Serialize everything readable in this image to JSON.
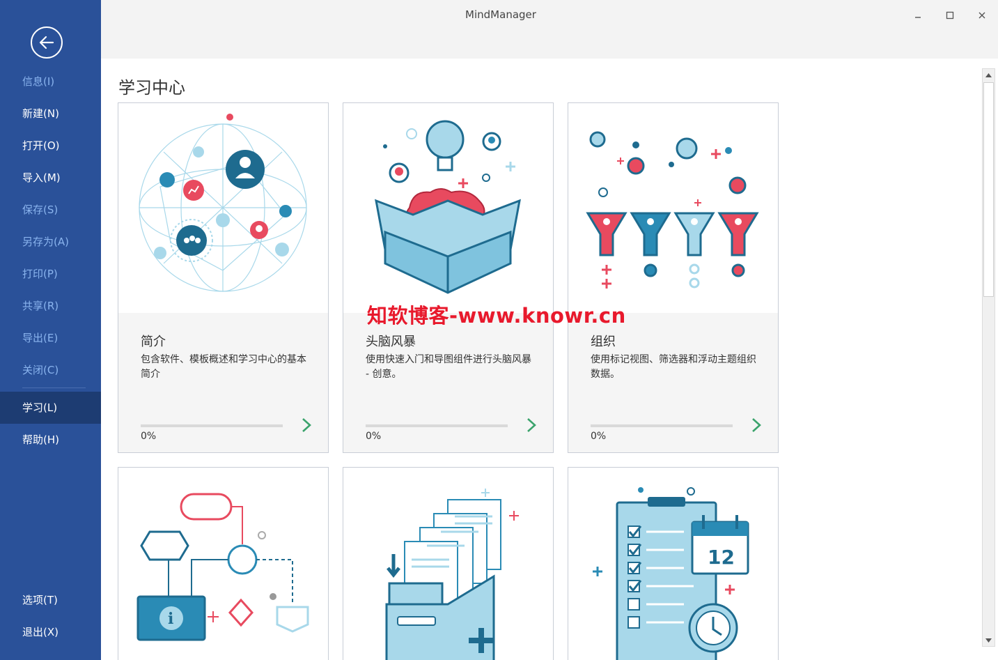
{
  "window": {
    "title": "MindManager"
  },
  "sidebar": {
    "items": [
      {
        "label": "信息(I)",
        "muted": true
      },
      {
        "label": "新建(N)",
        "muted": false
      },
      {
        "label": "打开(O)",
        "muted": false
      },
      {
        "label": "导入(M)",
        "muted": false
      },
      {
        "label": "保存(S)",
        "muted": true
      },
      {
        "label": "另存为(A)",
        "muted": true
      },
      {
        "label": "打印(P)",
        "muted": true
      },
      {
        "label": "共享(R)",
        "muted": true
      },
      {
        "label": "导出(E)",
        "muted": true
      },
      {
        "label": "关闭(C)",
        "muted": true
      },
      {
        "label": "学习(L)",
        "active": true
      },
      {
        "label": "帮助(H)",
        "muted": false
      }
    ],
    "bottom_items": [
      {
        "label": "选项(T)"
      },
      {
        "label": "退出(X)"
      }
    ]
  },
  "main": {
    "heading": "学习中心",
    "cards": [
      {
        "title": "简介",
        "description": "包含软件、模板概述和学习中心的基本简介",
        "progress_label": "0%",
        "progress": 0
      },
      {
        "title": "头脑风暴",
        "description": "使用快速入门和导图组件进行头脑风暴 - 创意。",
        "progress_label": "0%",
        "progress": 0
      },
      {
        "title": "组织",
        "description": "使用标记视图、筛选器和浮动主题组织数据。",
        "progress_label": "0%",
        "progress": 0
      }
    ],
    "calendar_number": "12"
  },
  "watermark": "知软博客-www.knowr.cn",
  "colors": {
    "sidebar_bg": "#2a5199",
    "sidebar_active": "#1d3c72",
    "accent_green": "#3ba36c",
    "illus_red": "#e84a5f",
    "illus_blue": "#2a8bb5",
    "illus_light": "#a8d8ea"
  }
}
